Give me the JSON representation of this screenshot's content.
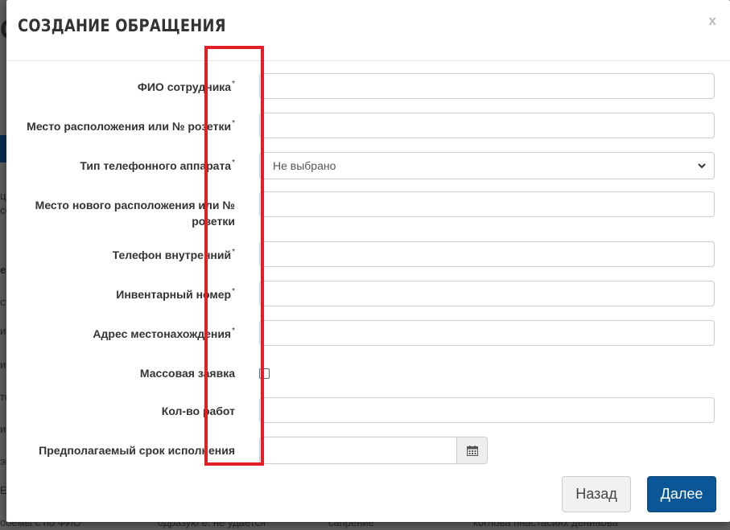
{
  "background_page": {
    "title_fragment": "С",
    "left_fragments": [
      "ц",
      "со",
      "ен",
      "ст",
      "и",
      "и",
      "то",
      "и",
      "эп",
      "Е"
    ],
    "bottom_row": [
      "ооемы с по ФИО",
      "одразую е. не удается",
      "сапрение",
      "коглова пнастасиях дениаова"
    ]
  },
  "modal": {
    "title": "СОЗДАНИЕ ОБРАЩЕНИЯ",
    "close_label": "x",
    "fields": [
      {
        "label": "ФИО сотрудника",
        "required": true
      },
      {
        "label": "Место расположения или № розетки",
        "required": true
      },
      {
        "label": "Тип телефонного аппарата",
        "required": true,
        "selected": "Не выбрано"
      },
      {
        "label": "Место нового расположения или № розетки",
        "required": false
      },
      {
        "label": "Телефон внутренний",
        "required": true
      },
      {
        "label": "Инвентарный номер",
        "required": true
      },
      {
        "label": "Адрес местонахождения",
        "required": true
      },
      {
        "label": "Массовая заявка",
        "required": false
      },
      {
        "label": "Кол-во работ",
        "required": false
      },
      {
        "label": "Предполагаемый срок исполнения",
        "required": false
      }
    ],
    "required_marker": "*",
    "buttons": {
      "back": "Назад",
      "next": "Далее"
    }
  },
  "colors": {
    "primary_button": "#0b5696",
    "highlight": "#e21f26"
  },
  "icons": {
    "close": "close-icon",
    "select": "chevron-down-icon",
    "date": "calendar-icon"
  }
}
